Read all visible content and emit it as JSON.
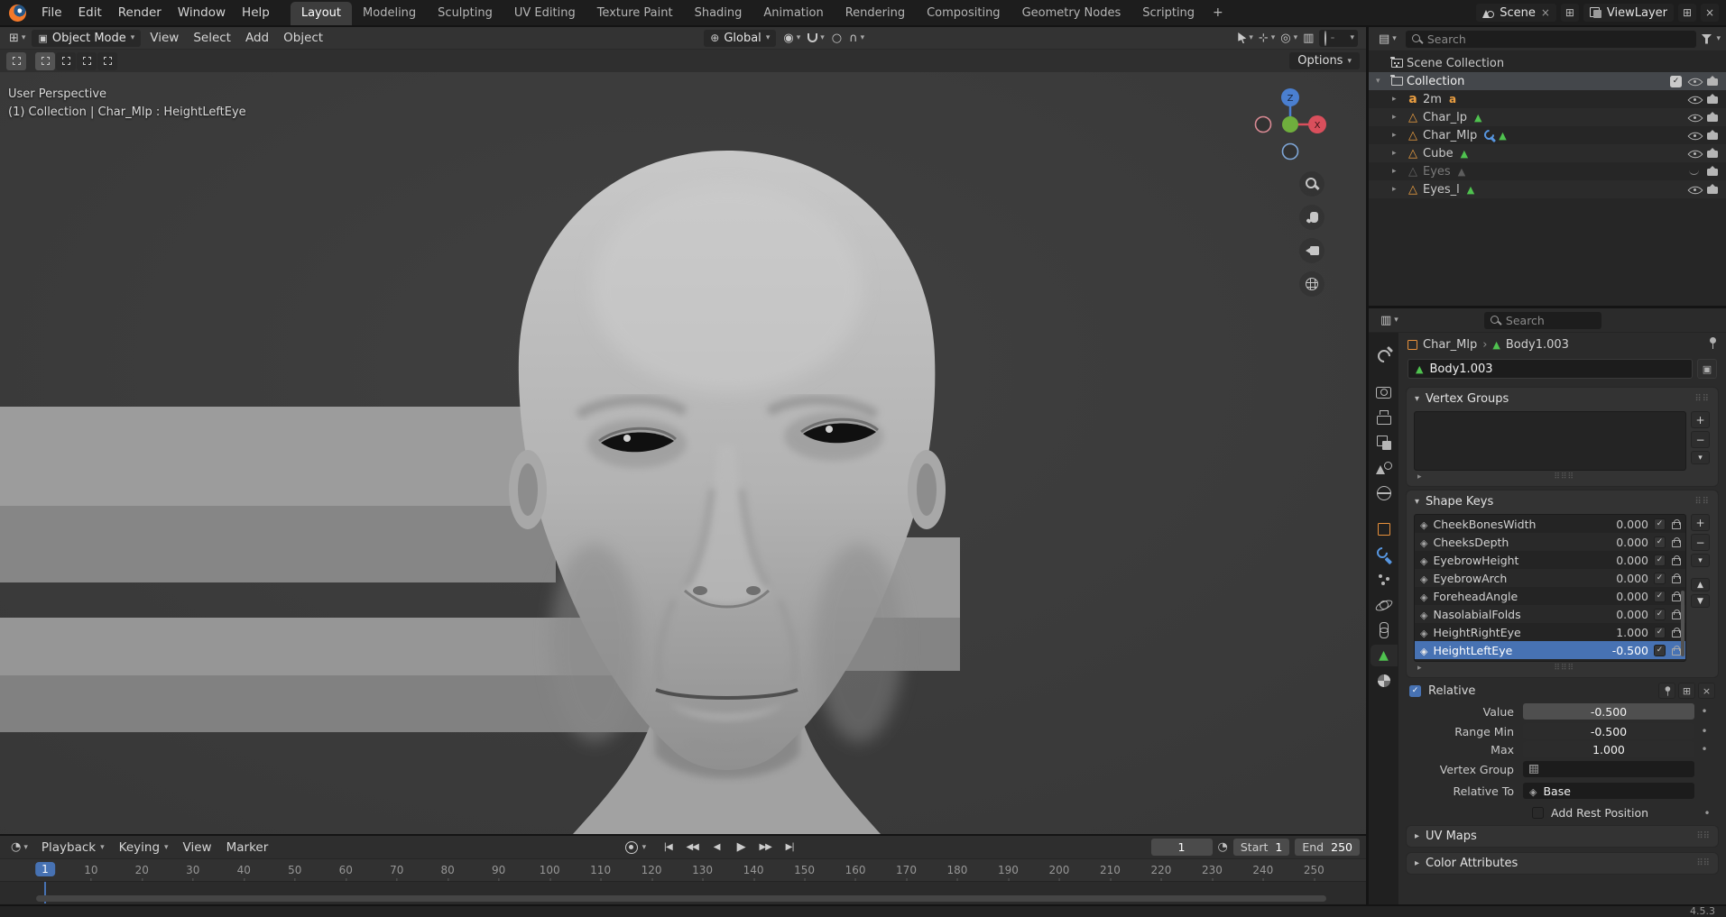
{
  "app": {
    "version": "4.5.3"
  },
  "topbar": {
    "menus": [
      {
        "label": "File"
      },
      {
        "label": "Edit"
      },
      {
        "label": "Render"
      },
      {
        "label": "Window"
      },
      {
        "label": "Help"
      }
    ],
    "workspaces": [
      {
        "label": "Layout",
        "active": true
      },
      {
        "label": "Modeling"
      },
      {
        "label": "Sculpting"
      },
      {
        "label": "UV Editing"
      },
      {
        "label": "Texture Paint"
      },
      {
        "label": "Shading"
      },
      {
        "label": "Animation"
      },
      {
        "label": "Rendering"
      },
      {
        "label": "Compositing"
      },
      {
        "label": "Geometry Nodes"
      },
      {
        "label": "Scripting"
      }
    ],
    "add_workspace_label": "+",
    "scene_selector": {
      "value": "Scene",
      "unlink": "×"
    },
    "viewlayer_selector": {
      "value": "ViewLayer",
      "unlink": "×"
    }
  },
  "viewport": {
    "header": {
      "mode": "Object Mode",
      "menus": [
        {
          "label": "View"
        },
        {
          "label": "Select"
        },
        {
          "label": "Add"
        },
        {
          "label": "Object"
        }
      ],
      "orientation": "Global",
      "options_label": "Options"
    },
    "overlay": {
      "view_label": "User Perspective",
      "context_label": "(1) Collection | Char_Mlp : HeightLeftEye"
    },
    "gizmo": {
      "x_label": "X",
      "z_label": "Z"
    }
  },
  "outliner": {
    "search_placeholder": "Search",
    "rows": [
      {
        "label": "Scene Collection",
        "icon": "scene-collection-icon",
        "depth": 0
      },
      {
        "label": "Collection",
        "icon": "collection-icon",
        "depth": 0,
        "arrow": "▾",
        "active": true,
        "checkbox": true,
        "eye": true,
        "camera": true
      },
      {
        "label": "2m",
        "icon": "font-object-icon",
        "depth": 1,
        "arrow": "▸",
        "badges": [
          "font-data-icon"
        ],
        "eye": true,
        "camera": true
      },
      {
        "label": "Char_lp",
        "icon": "mesh-object-icon",
        "depth": 1,
        "arrow": "▸",
        "badges": [
          "mesh-data-icon"
        ],
        "eye": true,
        "camera": true
      },
      {
        "label": "Char_Mlp",
        "icon": "mesh-object-icon",
        "depth": 1,
        "arrow": "▸",
        "badges": [
          "modifier-icon",
          "mesh-data-icon"
        ],
        "eye": true,
        "camera": true
      },
      {
        "label": "Cube",
        "icon": "mesh-object-icon",
        "depth": 1,
        "arrow": "▸",
        "badges": [
          "mesh-data-icon"
        ],
        "eye": true,
        "camera": true
      },
      {
        "label": "Eyes",
        "icon": "mesh-object-icon",
        "depth": 1,
        "arrow": "▸",
        "dimmed": true,
        "badges": [
          "mesh-data-icon"
        ],
        "eye_closed": true,
        "camera": true
      },
      {
        "label": "Eyes_l",
        "icon": "mesh-object-icon",
        "depth": 1,
        "arrow": "▸",
        "badges": [
          "mesh-data-icon"
        ],
        "eye": true,
        "camera": true
      }
    ]
  },
  "properties": {
    "search_placeholder": "Search",
    "tabs": [
      {
        "icon": "tool-tab-icon"
      },
      {
        "icon": "render-tab-icon",
        "group": true
      },
      {
        "icon": "output-tab-icon"
      },
      {
        "icon": "view-layer-tab-icon"
      },
      {
        "icon": "scene-tab-icon"
      },
      {
        "icon": "world-tab-icon"
      },
      {
        "icon": "object-tab-icon",
        "group": true
      },
      {
        "icon": "modifiers-tab-icon"
      },
      {
        "icon": "particles-tab-icon"
      },
      {
        "icon": "physics-tab-icon"
      },
      {
        "icon": "constraints-tab-icon"
      },
      {
        "icon": "object-data-tab-icon",
        "active": true
      },
      {
        "icon": "material-tab-icon"
      }
    ],
    "breadcrumb": {
      "object": "Char_Mlp",
      "separator": "›",
      "data": "Body1.003"
    },
    "name_value": "Body1.003",
    "panels": {
      "vertex_groups": "Vertex Groups",
      "shape_keys": "Shape Keys",
      "uv_maps": "UV Maps",
      "color_attributes": "Color Attributes"
    },
    "shape_keys": [
      {
        "name": "CheekBonesWidth",
        "value": "0.000"
      },
      {
        "name": "CheeksDepth",
        "value": "0.000"
      },
      {
        "name": "EyebrowHeight",
        "value": "0.000"
      },
      {
        "name": "EyebrowArch",
        "value": "0.000"
      },
      {
        "name": "ForeheadAngle",
        "value": "0.000"
      },
      {
        "name": "NasolabialFolds",
        "value": "0.000"
      },
      {
        "name": "HeightRightEye",
        "value": "1.000"
      },
      {
        "name": "HeightLeftEye",
        "value": "-0.500",
        "selected": true
      }
    ],
    "relative_label": "Relative",
    "value_row": {
      "label": "Value",
      "value": "-0.500"
    },
    "range_min_row": {
      "label": "Range Min",
      "value": "-0.500"
    },
    "max_row": {
      "label": "Max",
      "value": "1.000"
    },
    "vertex_group_row": {
      "label": "Vertex Group"
    },
    "relative_to_row": {
      "label": "Relative To",
      "value": "Base"
    },
    "add_rest_position_label": "Add Rest Position"
  },
  "timeline": {
    "menus": [
      {
        "label": "Playback",
        "caret": true
      },
      {
        "label": "Keying",
        "caret": true
      },
      {
        "label": "View"
      },
      {
        "label": "Marker"
      }
    ],
    "transport": [
      {
        "icon": "jump-to-start-icon",
        "glyph": "|◀"
      },
      {
        "icon": "prev-keyframe-icon",
        "glyph": "◀◀"
      },
      {
        "icon": "play-reverse-icon",
        "glyph": "◀"
      },
      {
        "icon": "play-icon",
        "glyph": "▶"
      },
      {
        "icon": "next-keyframe-icon",
        "glyph": "▶▶"
      },
      {
        "icon": "jump-to-end-icon",
        "glyph": "▶|"
      }
    ],
    "current_frame": "1",
    "start": {
      "label": "Start",
      "value": "1"
    },
    "end": {
      "label": "End",
      "value": "250"
    },
    "playhead_frame": 1,
    "ticks": [
      10,
      20,
      30,
      40,
      50,
      60,
      70,
      80,
      90,
      100,
      110,
      120,
      130,
      140,
      150,
      160,
      170,
      180,
      190,
      200,
      210,
      220,
      230,
      240,
      250
    ]
  }
}
